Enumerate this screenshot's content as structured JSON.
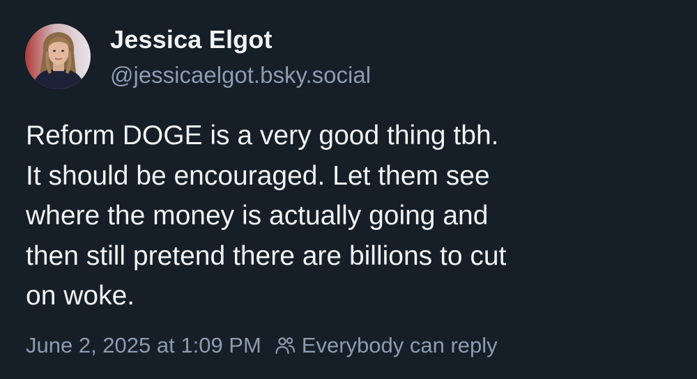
{
  "author": {
    "display_name": "Jessica Elgot",
    "handle": "@jessicaelgot.bsky.social"
  },
  "post": {
    "lines": [
      "Reform DOGE is a very good thing tbh.",
      "It should be encouraged. Let them see",
      "where the money is actually going and",
      "then still pretend there are billions to cut",
      "on woke."
    ]
  },
  "meta": {
    "timestamp": "June 2, 2025 at 1:09 PM",
    "reply_setting_icon": "people-icon",
    "reply_setting": "Everybody can reply"
  },
  "colors": {
    "background": "#161e27",
    "text": "#f1f3f5",
    "muted": "#8d9cb0"
  }
}
